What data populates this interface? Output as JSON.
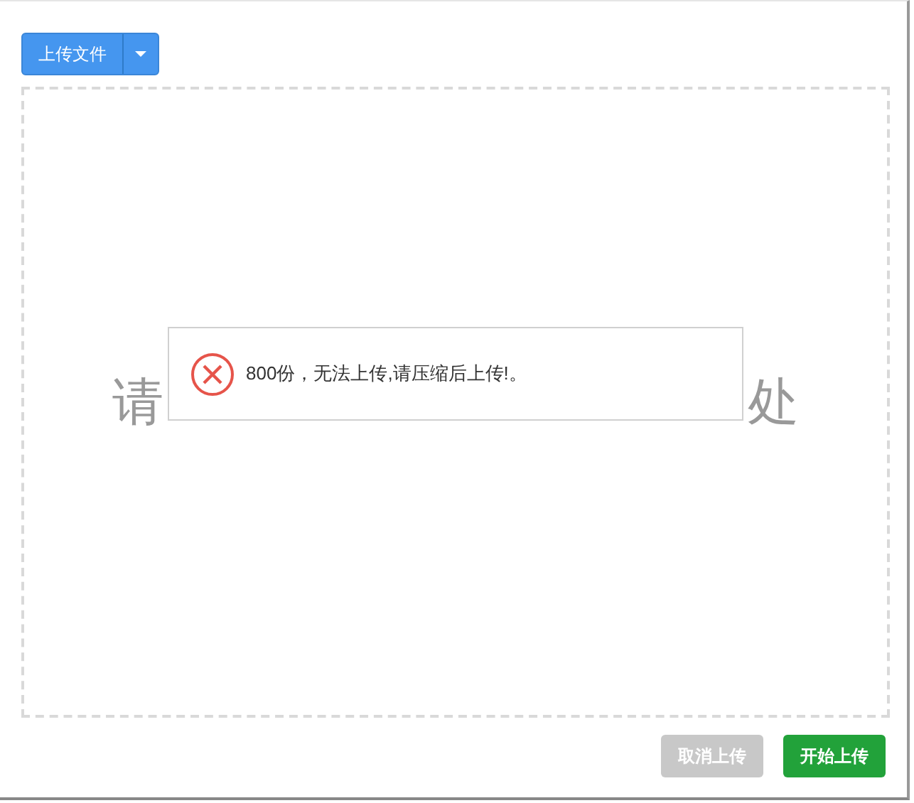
{
  "upload_button": {
    "label": "上传文件"
  },
  "drop_zone": {
    "visible_text_left": "请",
    "visible_text_right": "处"
  },
  "toast": {
    "kind": "error",
    "message": "800份，无法上传,请压缩后上传!。"
  },
  "buttons": [
    {
      "label": "取消上传",
      "disabled": true
    },
    {
      "label": "开始上传",
      "disabled": false
    }
  ]
}
